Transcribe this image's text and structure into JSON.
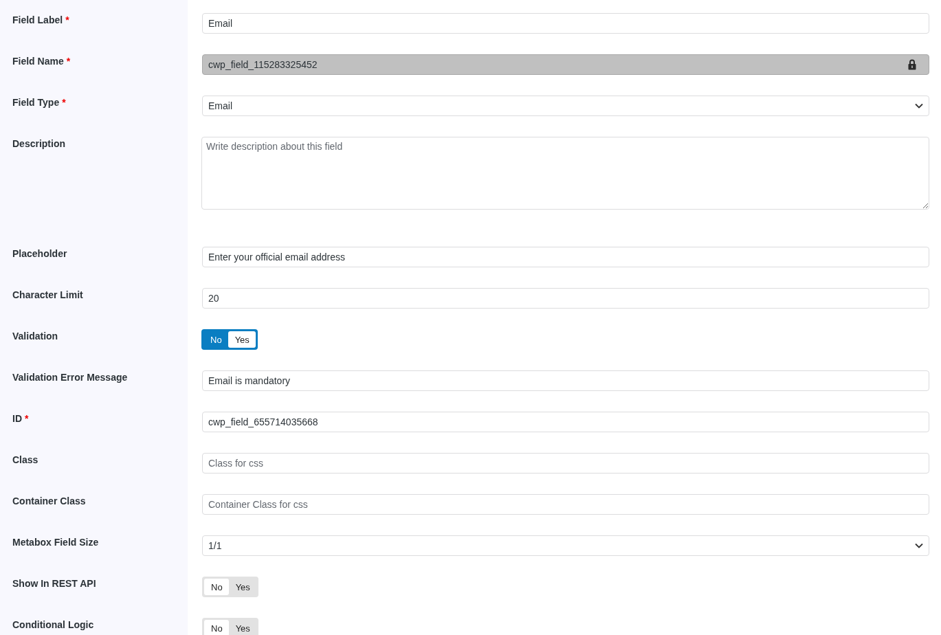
{
  "fields": [
    {
      "kind": "text",
      "label": "Field Label",
      "required_mark": "*",
      "value": "Email"
    },
    {
      "kind": "locked",
      "label": "Field Name",
      "required_mark": "*",
      "value": "cwp_field_115283325452"
    },
    {
      "kind": "select",
      "label": "Field Type",
      "required_mark": "*",
      "value": "Email"
    },
    {
      "kind": "textarea",
      "label": "Description",
      "placeholder": "Write description about this field"
    },
    {
      "kind": "text",
      "label": "Placeholder",
      "value": "Enter your official email address"
    },
    {
      "kind": "text",
      "label": "Character Limit",
      "value": "20"
    },
    {
      "kind": "toggle",
      "label": "Validation",
      "off_label": "No",
      "on_label": "Yes",
      "on": true
    },
    {
      "kind": "text",
      "label": "Validation Error Message",
      "value": "Email is mandatory"
    },
    {
      "kind": "text",
      "label": "ID",
      "required_mark": "*",
      "value": "cwp_field_655714035668"
    },
    {
      "kind": "text",
      "label": "Class",
      "placeholder": "Class for css"
    },
    {
      "kind": "text",
      "label": "Container Class",
      "placeholder": "Container Class for css"
    },
    {
      "kind": "select",
      "label": "Metabox Field Size",
      "value": "1/1"
    },
    {
      "kind": "toggle",
      "label": "Show In REST API",
      "off_label": "No",
      "on_label": "Yes",
      "on": false
    },
    {
      "kind": "toggle",
      "label": "Conditional Logic",
      "off_label": "No",
      "on_label": "Yes",
      "on": false
    }
  ]
}
